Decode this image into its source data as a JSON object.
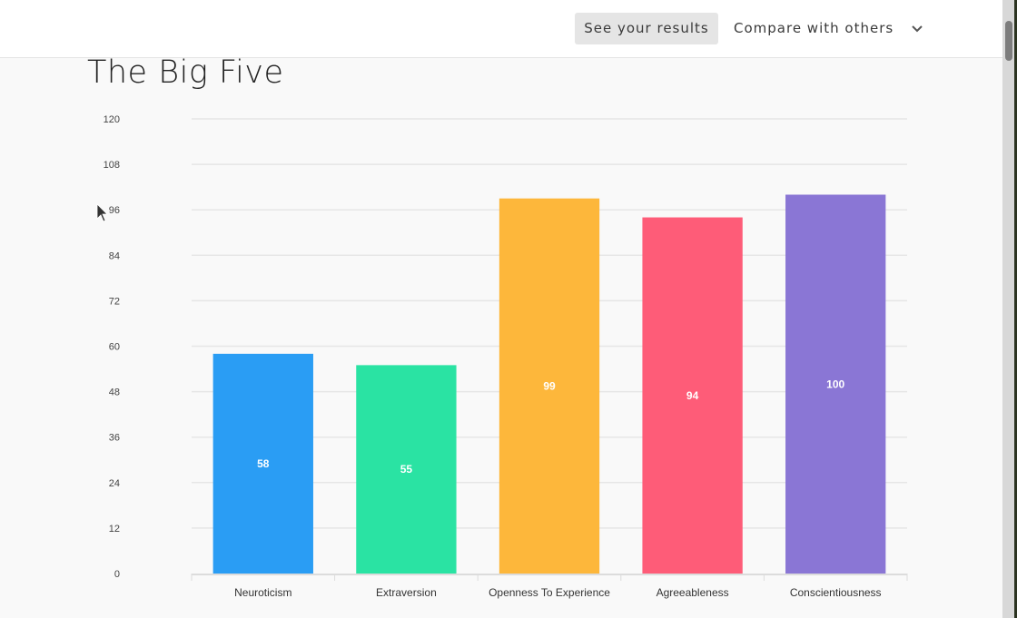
{
  "header": {
    "see_results_label": "See your results",
    "compare_label": "Compare with others",
    "dropdown_icon": "chevron-down-icon"
  },
  "page": {
    "title": "The Big Five"
  },
  "chart_data": {
    "type": "bar",
    "title": "The Big Five",
    "xlabel": "",
    "ylabel": "",
    "categories": [
      "Neuroticism",
      "Extraversion",
      "Openness To Experience",
      "Agreeableness",
      "Conscientiousness"
    ],
    "values": [
      58,
      55,
      99,
      94,
      100
    ],
    "data_labels": [
      "58",
      "55",
      "99",
      "94",
      "100"
    ],
    "colors": [
      "#2a9df4",
      "#2ae3a3",
      "#fdb73b",
      "#fe5c78",
      "#8a76d5"
    ],
    "ylim": [
      0,
      120
    ],
    "yticks": [
      0,
      12,
      24,
      36,
      48,
      60,
      72,
      84,
      96,
      108,
      120
    ],
    "grid": true,
    "legend": "none"
  }
}
